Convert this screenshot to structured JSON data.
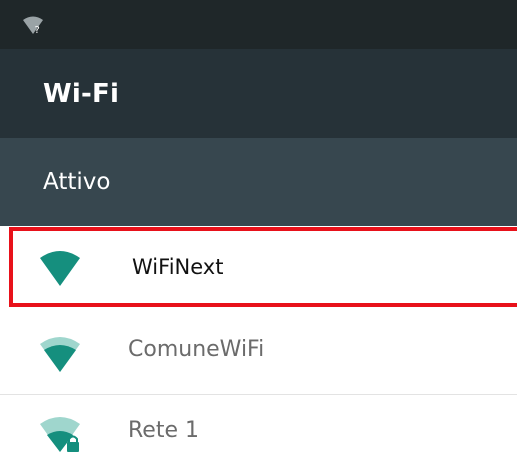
{
  "status_bar": {
    "wifi_icon": "wifi-no-internet-icon",
    "wifi_badge": "?"
  },
  "toolbar": {
    "title": "Wi-Fi"
  },
  "wifi_toggle": {
    "label": "Attivo"
  },
  "networks": [
    {
      "name": "WiFiNext",
      "icon": "wifi-signal-full-icon",
      "secured": false,
      "highlighted": true,
      "signal_level": 4
    },
    {
      "name": "ComuneWiFi",
      "icon": "wifi-signal-strong-icon",
      "secured": false,
      "highlighted": false,
      "signal_level": 3
    },
    {
      "name": "Rete 1",
      "icon": "wifi-signal-lock-icon",
      "secured": true,
      "highlighted": false,
      "signal_level": 2
    }
  ],
  "colors": {
    "status_bar": "#1f2729",
    "toolbar": "#263238",
    "toggle_bar": "#37474f",
    "wifi_accent": "#158f7e",
    "wifi_faded": "#9fd6cd",
    "highlight": "#e8111a"
  }
}
